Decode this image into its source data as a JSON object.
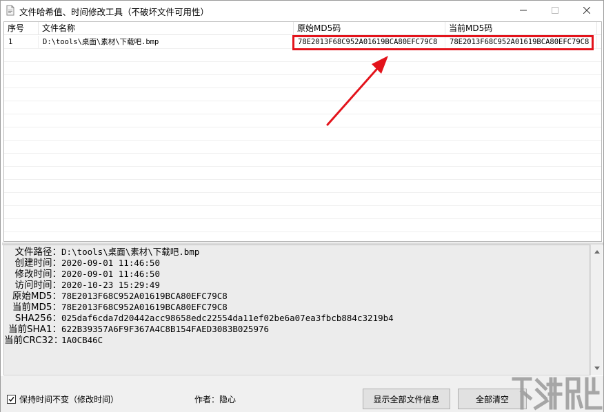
{
  "window": {
    "title": "文件哈希值、时间修改工具（不破坏文件可用性）"
  },
  "list": {
    "columns": [
      "序号",
      "文件名称",
      "原始MD5码",
      "当前MD5码"
    ],
    "rows": [
      {
        "no": "1",
        "name": "D:\\tools\\桌面\\素材\\下载吧.bmp",
        "orig_md5": "78E2013F68C952A01619BCA80EFC79C8",
        "cur_md5": "78E2013F68C952A01619BCA80EFC79C8"
      }
    ]
  },
  "info": {
    "lines": [
      {
        "label": "文件路径：",
        "value": "D:\\tools\\桌面\\素材\\下载吧.bmp"
      },
      {
        "label": "创建时间：",
        "value": "2020-09-01 11:46:50"
      },
      {
        "label": "修改时间：",
        "value": "2020-09-01 11:46:50"
      },
      {
        "label": "访问时间：",
        "value": "2020-10-23 15:29:49"
      },
      {
        "label": "原始MD5：",
        "value": "78E2013F68C952A01619BCA80EFC79C8"
      },
      {
        "label": "当前MD5：",
        "value": "78E2013F68C952A01619BCA80EFC79C8"
      },
      {
        "label": "SHA256：",
        "value": "025daf6cda7d20442acc98658edc22554da11ef02be6a07ea3fbcb884c3219b4"
      },
      {
        "label": "当前SHA1：",
        "value": "622B39357A6F9F367A4C8B154FAED3083B025976"
      },
      {
        "label": "当前CRC32：",
        "value": "1A0CB46C"
      }
    ]
  },
  "bottom": {
    "keep_time_label": "保持时间不变（修改时间）",
    "keep_time_checked": true,
    "author_label": "作者：隐心",
    "show_all_label": "显示全部文件信息",
    "clear_all_label": "全部清空"
  },
  "colors": {
    "highlight": "#e3131b",
    "panel_bg": "#ececec"
  }
}
